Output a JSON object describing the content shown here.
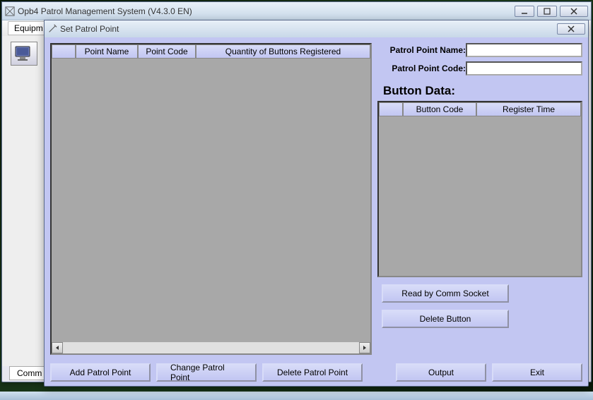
{
  "main_window": {
    "title": "Opb4  Patrol Management System (V4.3.0 EN)",
    "menu_first_visible": "Equipm",
    "bottom_first_visible": "Comm"
  },
  "dialog": {
    "title": "Set Patrol Point",
    "left_grid": {
      "columns": {
        "blank": "",
        "name": "Point Name",
        "code": "Point Code",
        "qty": "Quantity of Buttons Registered"
      }
    },
    "form": {
      "name_label": "Patrol Point Name:",
      "name_value": "",
      "code_label": "Patrol Point Code:",
      "code_value": ""
    },
    "button_data": {
      "title": "Button Data:",
      "columns": {
        "blank": "",
        "code": "Button Code",
        "time": "Register Time"
      }
    },
    "actions_right": {
      "read": "Read by Comm Socket",
      "delete_btn": "Delete Button"
    },
    "actions_bottom": {
      "add": "Add Patrol Point",
      "change": "Change Patrol Point",
      "delete_pt": "Delete Patrol Point",
      "output": "Output",
      "exit": "Exit"
    }
  }
}
